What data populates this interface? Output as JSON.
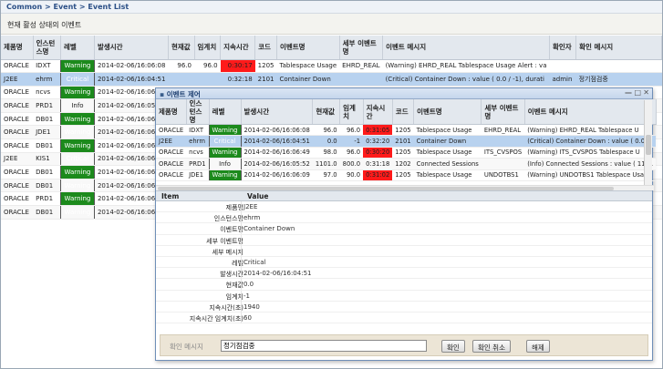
{
  "breadcrumb": "Common > Event > Event List",
  "subtitle": "현재 활성 상태의 이벤트",
  "colors": {
    "warning": "#1c8a1c",
    "critical": "#e02020",
    "info": "#ffff33",
    "duration_alert": "#ff1a1a",
    "selected": "#b8d2ef"
  },
  "main": {
    "headers": [
      "제품명",
      "인스턴스명",
      "레벨",
      "발생시간",
      "현재값",
      "임계치",
      "지속시간",
      "코드",
      "이벤트명",
      "세부 이벤트명",
      "이벤트 메시지",
      "확인자",
      "확인 메시지"
    ],
    "rows": [
      {
        "product": "ORACLE",
        "instance": "IDXT",
        "level": "Warning",
        "time": "2014-02-06/16:06:08",
        "value": "96.0",
        "threshold": "96.0",
        "duration": "0:30:17",
        "code": "1205",
        "event": "Tablespace Usage",
        "detail": "EHRD_REAL",
        "message": "(Warning) EHRD_REAL Tablespace Usage Alert : va",
        "confirmer": "",
        "confirm_msg": ""
      },
      {
        "product": "J2EE",
        "instance": "ehrm",
        "level": "Critical",
        "time": "2014-02-06/16:04:51",
        "value": "",
        "threshold": "",
        "duration": "0:32:18",
        "code": "2101",
        "event": "Container Down",
        "detail": "",
        "message": "(Critical) Container Down : value ( 0.0 / -1), durati",
        "confirmer": "admin",
        "confirm_msg": "정기점검중"
      },
      {
        "product": "ORACLE",
        "instance": "ncvs",
        "level": "Warning",
        "time": "2014-02-06/16:06:",
        "value": "",
        "threshold": "",
        "duration": "",
        "code": "",
        "event": "",
        "detail": "",
        "message": "",
        "confirmer": "",
        "confirm_msg": ""
      },
      {
        "product": "ORACLE",
        "instance": "PRD1",
        "level": "Info",
        "time": "2014-02-06/16:05:",
        "value": "",
        "threshold": "",
        "duration": "",
        "code": "",
        "event": "",
        "detail": "",
        "message": "",
        "confirmer": "",
        "confirm_msg": ""
      },
      {
        "product": "ORACLE",
        "instance": "DB01",
        "level": "Warning",
        "time": "2014-02-06/16:06:",
        "value": "",
        "threshold": "",
        "duration": "",
        "code": "",
        "event": "",
        "detail": "",
        "message": "",
        "confirmer": "",
        "confirm_msg": ""
      },
      {
        "product": "ORACLE",
        "instance": "JDE1",
        "level": "Warning",
        "time": "2014-02-06/16:06:",
        "value": "",
        "threshold": "",
        "duration": "",
        "code": "",
        "event": "",
        "detail": "",
        "message": "",
        "confirmer": "",
        "confirm_msg": ""
      },
      {
        "product": "ORACLE",
        "instance": "DB01",
        "level": "Warning",
        "time": "2014-02-06/16:06:",
        "value": "",
        "threshold": "",
        "duration": "",
        "code": "",
        "event": "",
        "detail": "",
        "message": "",
        "confirmer": "",
        "confirm_msg": ""
      },
      {
        "product": "J2EE",
        "instance": "KIS1",
        "level": "Critical",
        "time": "2014-02-06/16:06:",
        "value": "",
        "threshold": "",
        "duration": "",
        "code": "",
        "event": "",
        "detail": "",
        "message": "",
        "confirmer": "",
        "confirm_msg": ""
      },
      {
        "product": "ORACLE",
        "instance": "DB01",
        "level": "Warning",
        "time": "2014-02-06/16:06:",
        "value": "",
        "threshold": "",
        "duration": "",
        "code": "",
        "event": "",
        "detail": "",
        "message": "",
        "confirmer": "",
        "confirm_msg": ""
      },
      {
        "product": "ORACLE",
        "instance": "DB01",
        "level": "Warning",
        "time": "2014-02-06/16:06:",
        "value": "",
        "threshold": "",
        "duration": "",
        "code": "",
        "event": "",
        "detail": "",
        "message": "",
        "confirmer": "",
        "confirm_msg": ""
      },
      {
        "product": "ORACLE",
        "instance": "PRD1",
        "level": "Warning",
        "time": "2014-02-06/16:06:",
        "value": "",
        "threshold": "",
        "duration": "",
        "code": "",
        "event": "",
        "detail": "",
        "message": "",
        "confirmer": "",
        "confirm_msg": ""
      },
      {
        "product": "ORACLE",
        "instance": "DB01",
        "level": "Warning",
        "time": "2014-02-06/16:06:3",
        "value": "",
        "threshold": "",
        "duration": "",
        "code": "",
        "event": "",
        "detail": "",
        "message": "",
        "confirmer": "",
        "confirm_msg": ""
      }
    ]
  },
  "popup": {
    "title": "이벤트 제어",
    "headers": [
      "제품명",
      "인스턴스명",
      "레벨",
      "발생시간",
      "현재값",
      "임계치",
      "지속시간",
      "코드",
      "이벤트명",
      "세부 이벤트명",
      "이벤트 메시지"
    ],
    "rows": [
      {
        "product": "ORACLE",
        "instance": "IDXT",
        "level": "Warning",
        "time": "2014-02-06/16:06:08",
        "value": "96.0",
        "threshold": "96.0",
        "duration": "0:31:05",
        "code": "1205",
        "event": "Tablespace Usage",
        "detail": "EHRD_REAL",
        "message": "(Warning) EHRD_REAL Tablespace U"
      },
      {
        "product": "J2EE",
        "instance": "ehrm",
        "level": "Critical",
        "time": "2014-02-06/16:04:51",
        "value": "0.0",
        "threshold": "-1",
        "duration": "0:32:20",
        "code": "2101",
        "event": "Container Down",
        "detail": "",
        "message": "(Critical) Container Down : value ( 0.0"
      },
      {
        "product": "ORACLE",
        "instance": "ncvs",
        "level": "Warning",
        "time": "2014-02-06/16:06:49",
        "value": "98.0",
        "threshold": "96.0",
        "duration": "0:30:20",
        "code": "1205",
        "event": "Tablespace Usage",
        "detail": "ITS_CVSPOS",
        "message": "(Warning) ITS_CVSPOS Tablespace U"
      },
      {
        "product": "ORACLE",
        "instance": "PRD1",
        "level": "Info",
        "time": "2014-02-06/16:05:52",
        "value": "1101.0",
        "threshold": "800.0",
        "duration": "0:31:18",
        "code": "1202",
        "event": "Connected Sessions",
        "detail": "",
        "message": "(Info) Connected Sessions : value ( 1101"
      },
      {
        "product": "ORACLE",
        "instance": "JDE1",
        "level": "Warning",
        "time": "2014-02-06/16:06:09",
        "value": "97.0",
        "threshold": "90.0",
        "duration": "0:31:02",
        "code": "1205",
        "event": "Tablespace Usage",
        "detail": "UNDOTBS1",
        "message": "(Warning) UNDOTBS1 Tablespace Usa"
      }
    ],
    "detail_headers": {
      "item": "Item",
      "value": "Value"
    },
    "details": [
      {
        "key": "제품명",
        "value": "J2EE"
      },
      {
        "key": "인스턴스명",
        "value": "ehrm"
      },
      {
        "key": "이벤트명",
        "value": "Container Down"
      },
      {
        "key": "세부 이벤트명",
        "value": ""
      },
      {
        "key": "세부 메시지",
        "value": ""
      },
      {
        "key": "레벨",
        "value": "Critical"
      },
      {
        "key": "발생시간",
        "value": "2014-02-06/16:04:51"
      },
      {
        "key": "현재값",
        "value": "0.0"
      },
      {
        "key": "임계치",
        "value": "-1"
      },
      {
        "key": "지속시간(초)",
        "value": "1940"
      },
      {
        "key": "지속시간 임계치(초)",
        "value": "60"
      }
    ],
    "footer": {
      "label": "확인 메시지",
      "input_value": "정기점검중",
      "confirm_label": "확인",
      "cancel_confirm_label": "확인 취소",
      "release_label": "해제"
    }
  }
}
